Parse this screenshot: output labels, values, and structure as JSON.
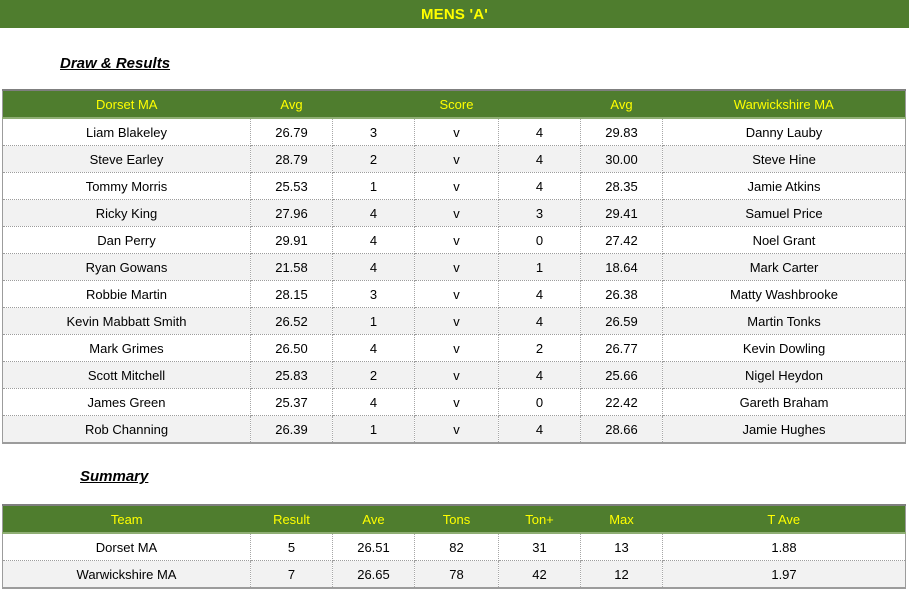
{
  "title": "MENS 'A'",
  "sections": {
    "draw_results_heading": "Draw & Results",
    "summary_heading": "Summary"
  },
  "colors": {
    "header_green": "#4F7D2E",
    "header_text_yellow": "#FFFF00",
    "alt_row": "#F2F2F2",
    "grid_line": "#9C9C9C"
  },
  "draw_results": {
    "headers": [
      "Dorset MA",
      "Avg",
      "",
      "Score",
      "",
      "Avg",
      "Warwickshire MA"
    ],
    "rows": [
      {
        "home_player": "Liam Blakeley",
        "home_avg": "26.79",
        "home_legs": "3",
        "score": "v",
        "away_legs": "4",
        "away_avg": "29.83",
        "away_player": "Danny Lauby"
      },
      {
        "home_player": "Steve Earley",
        "home_avg": "28.79",
        "home_legs": "2",
        "score": "v",
        "away_legs": "4",
        "away_avg": "30.00",
        "away_player": "Steve Hine"
      },
      {
        "home_player": "Tommy Morris",
        "home_avg": "25.53",
        "home_legs": "1",
        "score": "v",
        "away_legs": "4",
        "away_avg": "28.35",
        "away_player": "Jamie Atkins"
      },
      {
        "home_player": "Ricky King",
        "home_avg": "27.96",
        "home_legs": "4",
        "score": "v",
        "away_legs": "3",
        "away_avg": "29.41",
        "away_player": "Samuel Price"
      },
      {
        "home_player": "Dan Perry",
        "home_avg": "29.91",
        "home_legs": "4",
        "score": "v",
        "away_legs": "0",
        "away_avg": "27.42",
        "away_player": "Noel Grant"
      },
      {
        "home_player": "Ryan Gowans",
        "home_avg": "21.58",
        "home_legs": "4",
        "score": "v",
        "away_legs": "1",
        "away_avg": "18.64",
        "away_player": "Mark Carter"
      },
      {
        "home_player": "Robbie Martin",
        "home_avg": "28.15",
        "home_legs": "3",
        "score": "v",
        "away_legs": "4",
        "away_avg": "26.38",
        "away_player": "Matty Washbrooke"
      },
      {
        "home_player": "Kevin Mabbatt Smith",
        "home_avg": "26.52",
        "home_legs": "1",
        "score": "v",
        "away_legs": "4",
        "away_avg": "26.59",
        "away_player": "Martin Tonks"
      },
      {
        "home_player": "Mark Grimes",
        "home_avg": "26.50",
        "home_legs": "4",
        "score": "v",
        "away_legs": "2",
        "away_avg": "26.77",
        "away_player": "Kevin Dowling"
      },
      {
        "home_player": "Scott Mitchell",
        "home_avg": "25.83",
        "home_legs": "2",
        "score": "v",
        "away_legs": "4",
        "away_avg": "25.66",
        "away_player": "Nigel Heydon"
      },
      {
        "home_player": "James Green",
        "home_avg": "25.37",
        "home_legs": "4",
        "score": "v",
        "away_legs": "0",
        "away_avg": "22.42",
        "away_player": "Gareth Braham"
      },
      {
        "home_player": "Rob Channing",
        "home_avg": "26.39",
        "home_legs": "1",
        "score": "v",
        "away_legs": "4",
        "away_avg": "28.66",
        "away_player": "Jamie Hughes"
      }
    ]
  },
  "summary": {
    "headers": [
      "Team",
      "Result",
      "Ave",
      "Tons",
      "Ton+",
      "Max",
      "T Ave"
    ],
    "rows": [
      {
        "team": "Dorset MA",
        "result": "5",
        "ave": "26.51",
        "tons": "82",
        "ton_plus": "31",
        "max": "13",
        "t_ave": "1.88"
      },
      {
        "team": "Warwickshire MA",
        "result": "7",
        "ave": "26.65",
        "tons": "78",
        "ton_plus": "42",
        "max": "12",
        "t_ave": "1.97"
      }
    ]
  }
}
